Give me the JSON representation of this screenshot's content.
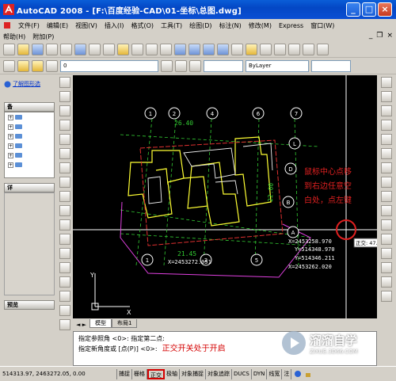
{
  "window": {
    "title": "AutoCAD 2008 - [F:\\百度经验-CAD\\01-坐标\\总图.dwg]"
  },
  "menu": {
    "row1": [
      "文件(F)",
      "编辑(E)",
      "视图(V)",
      "插入(I)",
      "格式(O)",
      "工具(T)",
      "绘图(D)",
      "标注(N)",
      "修改(M)",
      "Express",
      "窗口(W)"
    ],
    "row2": [
      "帮助(H)",
      "附加(P)"
    ]
  },
  "toolbar2": {
    "layer_value": "0",
    "linetype_value": "ByLayer"
  },
  "left_panel": {
    "link": "了解图形选",
    "sections": [
      {
        "label": "备"
      },
      {
        "label": "详"
      },
      {
        "label": "预览"
      }
    ]
  },
  "drawing": {
    "axis_top": [
      "1",
      "2",
      "4",
      "6",
      "7"
    ],
    "axis_right": [
      "L",
      "D",
      "B",
      "A"
    ],
    "axis_bottom": [
      "1",
      "3",
      "5"
    ],
    "dims": [
      "26.40",
      "22.00",
      "21.45"
    ],
    "coords": [
      "X=2453272.051",
      "Y=514348.970",
      "X=2453258.970",
      "Y=514346.211",
      "X=2453262.020"
    ],
    "tooltip": "正交: 47.16",
    "annotation": [
      "鼠标中心点移",
      "到右边任意空",
      "白处，点左键"
    ],
    "ucs": {
      "x": "X",
      "y": "Y"
    }
  },
  "tabs": [
    "模型",
    "布局1"
  ],
  "command": {
    "lines": [
      "指定参照角 <0>:  指定第二点:",
      "指定新角度或 [点(P)] <0>:"
    ],
    "annotation": "正交开关处于开启"
  },
  "watermark": {
    "text": "溜溜自学",
    "url": "ZIXUE.3D66.COM"
  },
  "status": {
    "coords": "514313.97, 2463272.05, 0.00",
    "buttons": [
      "捕捉",
      "栅格",
      "正交",
      "极轴",
      "对象捕捉",
      "对象追踪",
      "DUCS",
      "DYN",
      "线宽",
      "注"
    ]
  },
  "colors": {
    "annotation": "#d40000",
    "title": "#0a4fd3"
  }
}
